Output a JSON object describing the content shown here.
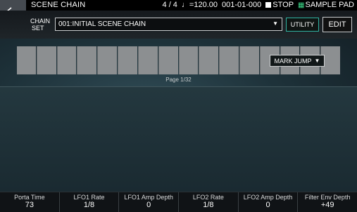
{
  "header": {
    "title": "SCENE CHAIN",
    "time_signature": "4 / 4",
    "tempo": "=120.00",
    "position": "001-01-000",
    "transport": "STOP",
    "sample_pad": "SAMPLE PAD"
  },
  "chain": {
    "label_line1": "CHAIN",
    "label_line2": "SET",
    "selected": "001:INITIAL SCENE CHAIN",
    "utility_label": "UTILITY",
    "edit_label": "EDIT"
  },
  "pads": {
    "count": 16
  },
  "page_indicator": "Page  1/32",
  "mark_jump_label": "MARK JUMP",
  "params": [
    {
      "label": "Porta Time",
      "value": "73"
    },
    {
      "label": "LFO1 Rate",
      "value": "1/8"
    },
    {
      "label": "LFO1 Amp Depth",
      "value": "0"
    },
    {
      "label": "LFO2 Rate",
      "value": "1/8"
    },
    {
      "label": "LFO2 Amp Depth",
      "value": "0"
    },
    {
      "label": "Filter Env Depth",
      "value": "+49"
    }
  ],
  "colors": {
    "accent_green": "#3dd889",
    "utility_border": "#2fb3a1"
  }
}
